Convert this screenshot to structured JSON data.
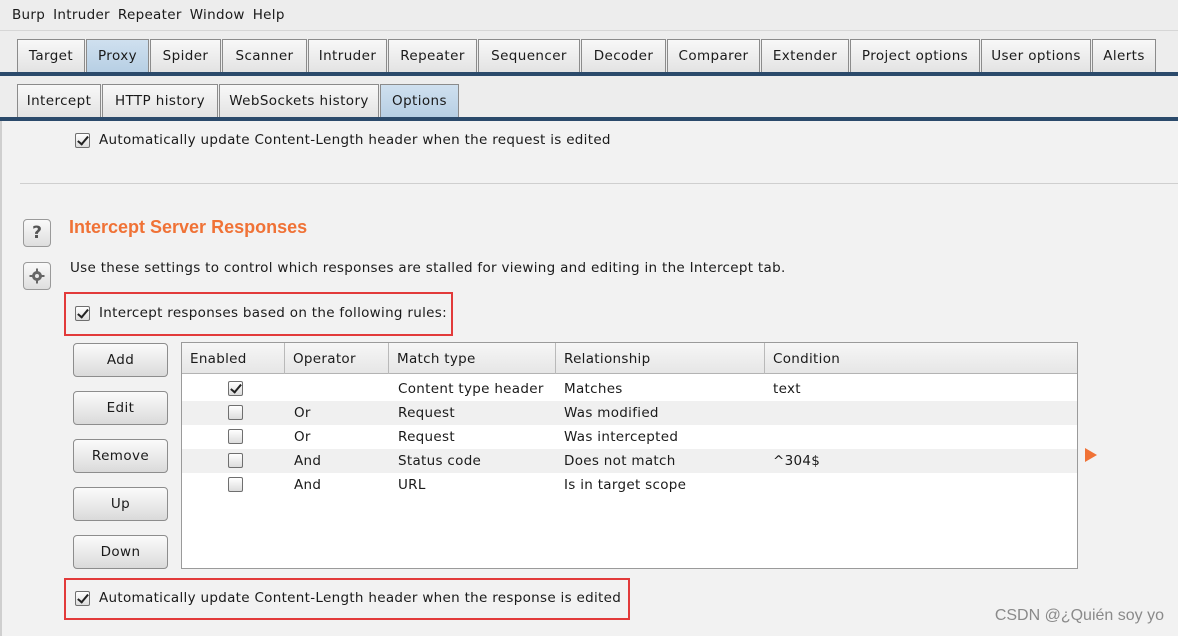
{
  "menu": [
    "Burp",
    "Intruder",
    "Repeater",
    "Window",
    "Help"
  ],
  "main_tabs": [
    "Target",
    "Proxy",
    "Spider",
    "Scanner",
    "Intruder",
    "Repeater",
    "Sequencer",
    "Decoder",
    "Comparer",
    "Extender",
    "Project options",
    "User options",
    "Alerts"
  ],
  "main_tab_selected": "Proxy",
  "sub_tabs": [
    "Intercept",
    "HTTP history",
    "WebSockets history",
    "Options"
  ],
  "sub_tab_selected": "Options",
  "top_option": {
    "label": "Automatically update Content-Length header when the request is edited",
    "checked": true
  },
  "section": {
    "help_icon": "help-icon",
    "settings_icon": "gear-icon",
    "title": "Intercept Server Responses",
    "description": "Use these settings to control which responses are stalled for viewing and editing in the Intercept tab.",
    "intercept_rule": {
      "label": "Intercept responses based on the following rules:",
      "checked": true
    },
    "buttons": [
      "Add",
      "Edit",
      "Remove",
      "Up",
      "Down"
    ],
    "table": {
      "columns": [
        "Enabled",
        "Operator",
        "Match type",
        "Relationship",
        "Condition"
      ],
      "rows": [
        {
          "enabled": true,
          "operator": "",
          "match_type": "Content type header",
          "relationship": "Matches",
          "condition": "text"
        },
        {
          "enabled": false,
          "operator": "Or",
          "match_type": "Request",
          "relationship": "Was modified",
          "condition": ""
        },
        {
          "enabled": false,
          "operator": "Or",
          "match_type": "Request",
          "relationship": "Was intercepted",
          "condition": ""
        },
        {
          "enabled": false,
          "operator": "And",
          "match_type": "Status code",
          "relationship": "Does not match",
          "condition": "^304$"
        },
        {
          "enabled": false,
          "operator": "And",
          "match_type": "URL",
          "relationship": "Is in target scope",
          "condition": ""
        }
      ]
    },
    "bottom_option": {
      "label": "Automatically update Content-Length header when the response is edited",
      "checked": true
    }
  },
  "watermark": "CSDN @¿Quién soy yo",
  "colors": {
    "accent_orange": "#f07236",
    "highlight_red": "#e23a3a",
    "tab_line": "#2b4a6b"
  }
}
